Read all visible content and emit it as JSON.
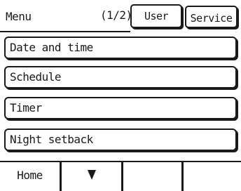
{
  "header": {
    "menu_label": "Menu",
    "page_indicator": "(1/2)",
    "tabs": [
      {
        "label": "User",
        "active": true
      },
      {
        "label": "Service",
        "active": false
      }
    ]
  },
  "menu_items": [
    {
      "label": "Date and time"
    },
    {
      "label": "Schedule"
    },
    {
      "label": "Timer"
    },
    {
      "label": "Night setback"
    }
  ],
  "footer": {
    "buttons": [
      {
        "label": "Home"
      },
      {
        "icon": "down-arrow-icon"
      },
      {
        "label": ""
      },
      {
        "label": ""
      }
    ]
  },
  "colors": {
    "foreground": "#1a1a1a",
    "background": "#ffffff"
  }
}
